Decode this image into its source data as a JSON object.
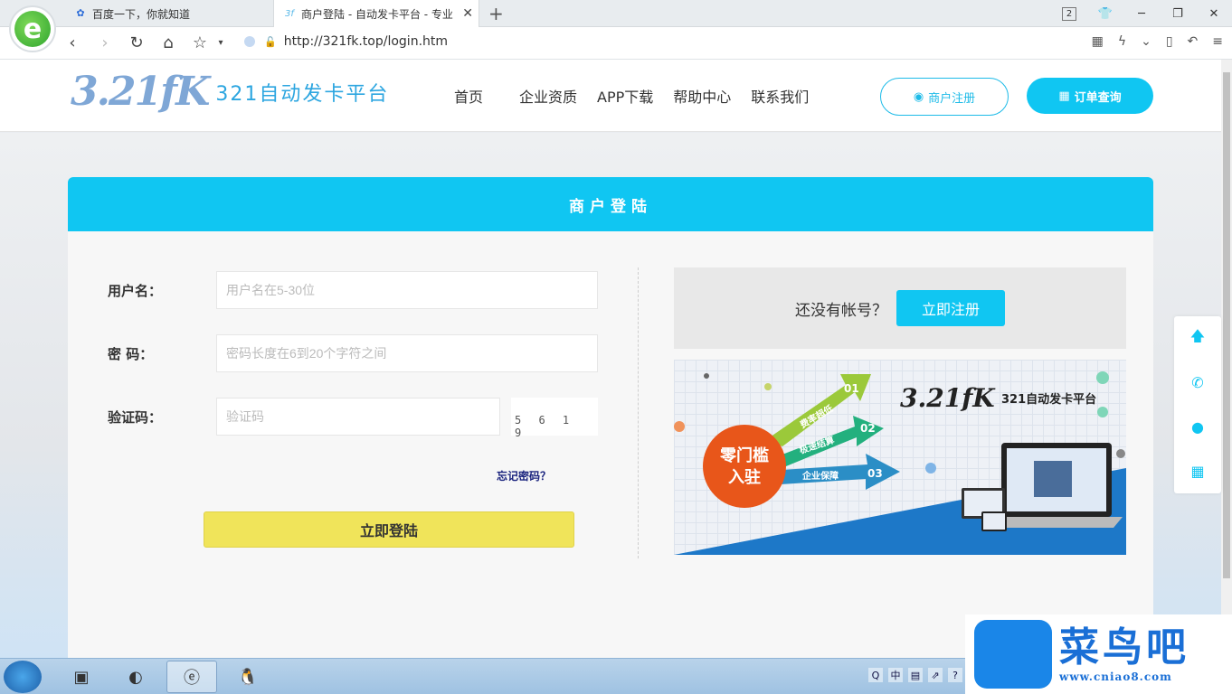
{
  "browser": {
    "tabs": [
      {
        "title": "百度一下，你就知道"
      },
      {
        "title": "商户登陆 - 自动发卡平台 - 专业"
      }
    ],
    "tab_count_badge": "2",
    "url": "http://321fk.top/login.htm"
  },
  "site": {
    "logo_mark": "3.21fK",
    "logo_text": "321自动发卡平台",
    "nav": [
      "首页",
      "企业资质",
      "APP下载",
      "帮助中心",
      "联系我们"
    ],
    "register_button": "商户注册",
    "order_button": "订单查询"
  },
  "login": {
    "title": "商户登陆",
    "username_label": "用户名：",
    "username_placeholder": "用户名在5-30位",
    "password_label": "密 码：",
    "password_placeholder": "密码长度在6到20个字符之间",
    "captcha_label": "验证码：",
    "captcha_placeholder": "验证码",
    "captcha_image_text": "5 6 1 9",
    "forgot_link": "忘记密码？",
    "submit_button": "立即登陆"
  },
  "register_prompt": {
    "text": "还没有帐号？",
    "button": "立即注册"
  },
  "promo_banner": {
    "badge_line1": "零门槛",
    "badge_line2": "入驻",
    "arrows": [
      {
        "label": "费率超低",
        "num": "01"
      },
      {
        "label": "极速结算",
        "num": "02"
      },
      {
        "label": "企业保障",
        "num": "03"
      }
    ],
    "brand_mark": "3.21fK",
    "brand_text": "321自动发卡平台"
  },
  "watermark": {
    "text": "菜鸟吧",
    "url": "www.cniao8.com"
  },
  "taskbar": {
    "tray_lang": "中"
  },
  "colors": {
    "accent": "#10c6f2",
    "login_button": "#f0e45a"
  }
}
